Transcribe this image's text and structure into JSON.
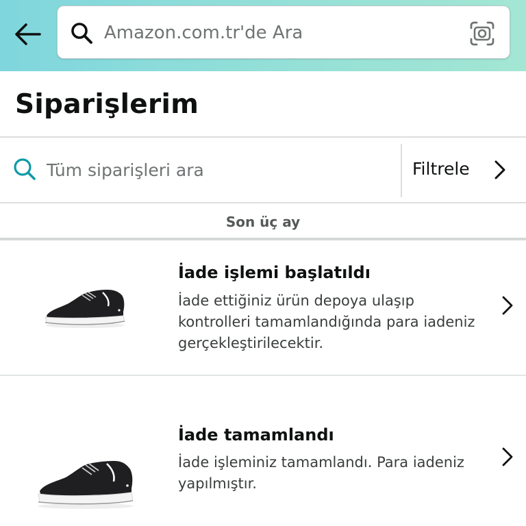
{
  "header": {
    "back_icon": "arrow-left-icon",
    "search": {
      "placeholder": "Amazon.com.tr'de Ara",
      "search_icon": "search-icon",
      "camera_icon": "camera-scan-icon"
    },
    "gradient_colors": [
      "#7fd6dd",
      "#a3e6d3"
    ]
  },
  "page": {
    "title": "Siparişlerim"
  },
  "order_search": {
    "placeholder": "Tüm siparişleri ara",
    "icon": "search-icon",
    "icon_color": "#0e9aa7"
  },
  "filter": {
    "label": "Filtrele",
    "icon": "chevron-right-icon"
  },
  "period": {
    "label": "Son üç ay"
  },
  "orders": [
    {
      "title": "İade işlemi başlatıldı",
      "description": "İade ettiğiniz ürün depoya ulaşıp kontrolleri tamamlandığında para iadeniz gerçekleştirilecektir.",
      "image_icon": "sneaker-image",
      "chevron_icon": "chevron-right-icon"
    },
    {
      "title": "İade tamamlandı",
      "description": "İade işleminiz tamamlandı. Para iadeniz yapılmıştır.",
      "image_icon": "sneaker-image",
      "chevron_icon": "chevron-right-icon"
    }
  ]
}
